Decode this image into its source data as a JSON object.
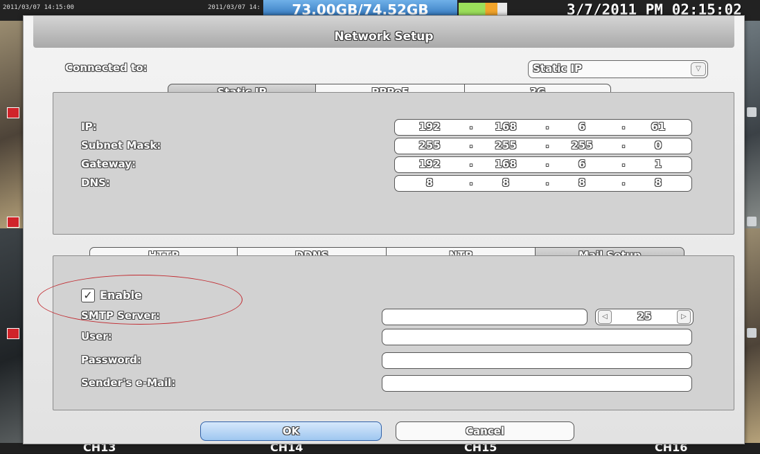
{
  "top_bar": {
    "timestamps": [
      "2011/03/07 14:15:00",
      "2011/03/07 14:"
    ],
    "disk_usage": "73.00GB/74.52GB",
    "clock": "3/7/2011 PM 02:15:02"
  },
  "channels": [
    "CH13",
    "CH14",
    "CH15",
    "CH16"
  ],
  "dialog": {
    "title": "Network Setup",
    "connected_to_label": "Connected to:",
    "connection_select": {
      "value": "Static IP"
    },
    "connection_tabs": [
      {
        "label": "Static IP",
        "active": true
      },
      {
        "label": "PPPoE",
        "active": false
      },
      {
        "label": "3G",
        "active": false
      }
    ],
    "ip_settings": [
      {
        "label": "IP:",
        "octets": [
          "192",
          "168",
          "6",
          "61"
        ]
      },
      {
        "label": "Subnet Mask:",
        "octets": [
          "255",
          "255",
          "255",
          "0"
        ]
      },
      {
        "label": "Gateway:",
        "octets": [
          "192",
          "168",
          "6",
          "1"
        ]
      },
      {
        "label": "DNS:",
        "octets": [
          "8",
          "8",
          "8",
          "8"
        ]
      }
    ],
    "service_tabs": [
      {
        "label": "HTTP",
        "active": false
      },
      {
        "label": "DDNS",
        "active": false
      },
      {
        "label": "NTP",
        "active": false
      },
      {
        "label": "Mail Setup",
        "active": true
      }
    ],
    "mail": {
      "enable_label": "Enable",
      "enable_checked": true,
      "smtp_server_label": "SMTP Server:",
      "smtp_server_value": "",
      "smtp_port": "25",
      "user_label": "User:",
      "user_value": "",
      "password_label": "Password:",
      "password_value": "",
      "sender_label": "Sender's e-Mail:",
      "sender_value": ""
    },
    "ok_label": "OK",
    "cancel_label": "Cancel"
  },
  "annotation_color": "#c1272d"
}
